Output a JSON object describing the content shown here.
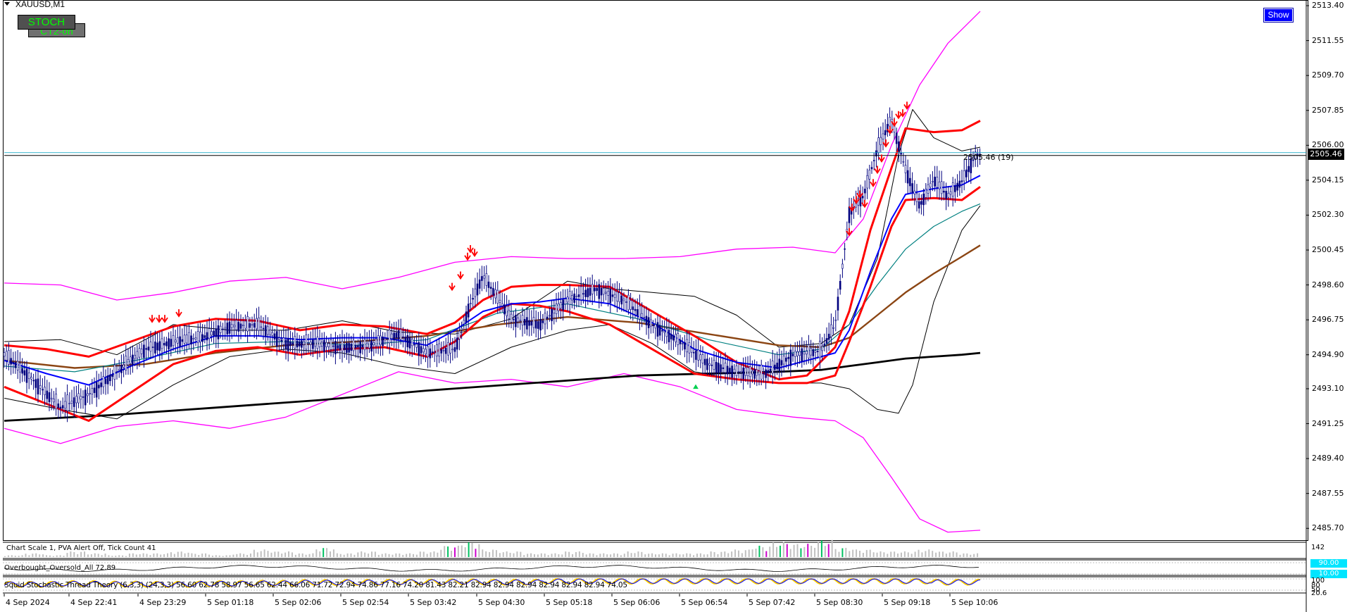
{
  "header": {
    "symbol_label": "XAUUSD,M1"
  },
  "buttons": {
    "stoch_label": "STOCH",
    "ct2_label": "CT2-on",
    "show_label": "Show"
  },
  "bid": {
    "price_label": "2505.46",
    "tick_label": "2505.46 (19)"
  },
  "info_line": {
    "text": "Chart Scale  1,  PVA Alert Off,  Tick Count  41"
  },
  "overbought_line": {
    "text": "Overbought_Oversold_All 72.89"
  },
  "stochastic_line": {
    "text": "Squid Stochastic Thread Theory (6,3,3) (24,3,3) 56.60 62.78 58.97 56.65 62.44 66.06 71.72 72.94 74.86 77.16 74.20 81.43 82.21 82.94 82.94 82.94 82.94 82.94 82.94 74.05"
  },
  "sub_windows": {
    "volume_scale_label": "142",
    "ob_top_label": "90.00",
    "ob_bottom_label": "10.00",
    "stoch_scale_labels": [
      "100",
      "80",
      "50",
      "20.6"
    ]
  },
  "colors": {
    "candle": "#00007f",
    "band_outer": "#ff00ff",
    "band_red": "#ff0000",
    "ma_blue": "#0000ff",
    "ma_teal": "#008080",
    "ma_brown": "#8b4513",
    "ma_black": "#000000",
    "arrow": "#ff0000",
    "volume_bar": "#c0c0c0",
    "volume_green": "#00c060",
    "volume_purple": "#cc00cc",
    "stoch_yellow": "#ffcc00",
    "stoch_blue": "#0000ff"
  },
  "chart_data": {
    "type": "line",
    "title": "XAUUSD,M1",
    "x_labels": [
      "4 Sep 2024",
      "4 Sep 22:41",
      "4 Sep 23:29",
      "5 Sep 01:18",
      "5 Sep 02:06",
      "5 Sep 02:54",
      "5 Sep 03:42",
      "5 Sep 04:30",
      "5 Sep 05:18",
      "5 Sep 06:06",
      "5 Sep 06:54",
      "5 Sep 07:42",
      "5 Sep 08:30",
      "5 Sep 09:18",
      "5 Sep 10:06"
    ],
    "y_ticks": [
      2513.4,
      2511.55,
      2509.7,
      2507.85,
      2506.0,
      2504.15,
      2502.3,
      2500.45,
      2498.6,
      2496.75,
      2494.9,
      2493.1,
      2491.25,
      2489.4,
      2487.55,
      2485.7
    ],
    "ylim": [
      2485.0,
      2513.7
    ],
    "current_price": 2505.46,
    "grid": false,
    "series": [
      {
        "style": "candles",
        "x": [
          0,
          40,
          80,
          120,
          160,
          200,
          240,
          280,
          320,
          360,
          400,
          440,
          480,
          520,
          560,
          600,
          640,
          660,
          680,
          720,
          760,
          800,
          840,
          880,
          920,
          960,
          1000,
          1040,
          1080,
          1120,
          1160,
          1180,
          1200,
          1220,
          1240,
          1260,
          1280,
          1300,
          1320,
          1340,
          1360,
          1380
        ],
        "values": [
          2494.9,
          2493.6,
          2492.1,
          2492.8,
          2494.0,
          2495.2,
          2495.6,
          2495.8,
          2496.4,
          2496.5,
          2495.5,
          2495.5,
          2495.3,
          2495.4,
          2496.0,
          2495.0,
          2495.2,
          2497.4,
          2499.1,
          2496.8,
          2496.5,
          2497.8,
          2498.4,
          2497.8,
          2496.5,
          2495.6,
          2494.4,
          2494.0,
          2493.9,
          2494.9,
          2495.1,
          2496.5,
          2502.4,
          2503.3,
          2505.8,
          2507.4,
          2504.7,
          2502.8,
          2504.2,
          2503.3,
          2504.1,
          2505.5
        ]
      },
      {
        "style": "upper-outer-band",
        "x": [
          0,
          80,
          160,
          240,
          320,
          400,
          480,
          560,
          640,
          720,
          800,
          880,
          960,
          1040,
          1120,
          1180,
          1220,
          1260,
          1300,
          1340,
          1386
        ],
        "values": [
          2498.7,
          2498.6,
          2497.8,
          2498.2,
          2498.8,
          2499.0,
          2498.4,
          2499.0,
          2499.8,
          2500.1,
          2500.0,
          2500.0,
          2500.1,
          2500.5,
          2500.6,
          2500.3,
          2502.1,
          2506.0,
          2509.2,
          2511.4,
          2513.1
        ]
      },
      {
        "style": "lower-outer-band",
        "x": [
          0,
          80,
          160,
          240,
          320,
          400,
          480,
          560,
          640,
          720,
          800,
          880,
          960,
          1040,
          1120,
          1180,
          1220,
          1260,
          1300,
          1340,
          1386
        ],
        "values": [
          2491.0,
          2490.2,
          2491.1,
          2491.4,
          2491.0,
          2491.6,
          2492.8,
          2494.0,
          2493.4,
          2493.6,
          2493.2,
          2493.9,
          2493.2,
          2492.0,
          2491.6,
          2491.4,
          2490.5,
          2488.4,
          2486.2,
          2485.5,
          2485.6
        ]
      },
      {
        "style": "red-upper",
        "x": [
          0,
          60,
          120,
          180,
          240,
          300,
          360,
          420,
          480,
          540,
          600,
          640,
          680,
          720,
          760,
          800,
          860,
          920,
          980,
          1040,
          1100,
          1140,
          1180,
          1200,
          1230,
          1260,
          1280,
          1320,
          1360,
          1386
        ],
        "values": [
          2495.4,
          2495.2,
          2494.8,
          2495.6,
          2496.4,
          2496.8,
          2496.7,
          2496.2,
          2496.5,
          2496.4,
          2496.0,
          2496.6,
          2497.8,
          2498.5,
          2498.6,
          2498.6,
          2498.5,
          2497.2,
          2495.9,
          2494.5,
          2493.6,
          2493.8,
          2495.3,
          2497.2,
          2501.5,
          2504.8,
          2506.9,
          2506.7,
          2506.8,
          2507.3
        ]
      },
      {
        "style": "red-lower",
        "x": [
          0,
          60,
          120,
          180,
          240,
          300,
          360,
          420,
          480,
          540,
          600,
          640,
          680,
          720,
          760,
          800,
          860,
          920,
          980,
          1040,
          1100,
          1140,
          1180,
          1200,
          1230,
          1260,
          1280,
          1320,
          1360,
          1386
        ],
        "values": [
          2493.2,
          2492.3,
          2491.4,
          2492.9,
          2494.4,
          2495.1,
          2495.3,
          2494.9,
          2495.2,
          2495.3,
          2494.8,
          2495.6,
          2496.9,
          2497.6,
          2497.5,
          2497.2,
          2496.5,
          2495.2,
          2493.9,
          2493.6,
          2493.4,
          2493.4,
          2493.8,
          2495.6,
          2498.5,
          2501.7,
          2503.1,
          2503.2,
          2503.1,
          2503.8
        ]
      },
      {
        "style": "blue-ma",
        "x": [
          0,
          60,
          120,
          180,
          240,
          300,
          360,
          420,
          480,
          540,
          600,
          640,
          680,
          720,
          760,
          800,
          860,
          920,
          980,
          1040,
          1100,
          1140,
          1180,
          1200,
          1230,
          1260,
          1280,
          1320,
          1360,
          1386
        ],
        "values": [
          2494.6,
          2493.9,
          2493.3,
          2494.3,
          2495.2,
          2495.9,
          2495.9,
          2495.7,
          2495.8,
          2495.8,
          2495.4,
          2496.2,
          2497.2,
          2497.6,
          2497.7,
          2497.9,
          2497.6,
          2496.6,
          2495.2,
          2494.5,
          2494.2,
          2494.6,
          2495.0,
          2496.2,
          2499.3,
          2502.1,
          2503.4,
          2503.7,
          2503.9,
          2504.4
        ]
      },
      {
        "style": "teal-ma",
        "x": [
          0,
          100,
          200,
          300,
          400,
          500,
          600,
          700,
          800,
          900,
          1000,
          1100,
          1160,
          1200,
          1240,
          1280,
          1320,
          1360,
          1386
        ],
        "values": [
          2494.3,
          2494.0,
          2494.7,
          2495.5,
          2495.6,
          2495.4,
          2495.7,
          2497.1,
          2497.6,
          2496.8,
          2495.7,
          2494.9,
          2495.2,
          2496.5,
          2498.6,
          2500.5,
          2501.7,
          2502.5,
          2502.9
        ]
      },
      {
        "style": "brown-ma",
        "x": [
          0,
          100,
          200,
          300,
          400,
          500,
          600,
          700,
          800,
          900,
          1000,
          1100,
          1160,
          1200,
          1240,
          1280,
          1320,
          1360,
          1386
        ],
        "values": [
          2494.6,
          2494.2,
          2494.4,
          2495.0,
          2495.4,
          2495.6,
          2495.9,
          2496.5,
          2496.9,
          2496.6,
          2496.0,
          2495.4,
          2495.3,
          2495.8,
          2497.0,
          2498.2,
          2499.2,
          2500.1,
          2500.7
        ]
      },
      {
        "style": "black-ma",
        "x": [
          0,
          150,
          300,
          450,
          600,
          750,
          900,
          1000,
          1100,
          1160,
          1200,
          1240,
          1280,
          1320,
          1360,
          1386
        ],
        "values": [
          2491.4,
          2491.7,
          2492.1,
          2492.5,
          2493.0,
          2493.4,
          2493.8,
          2493.9,
          2494.0,
          2494.1,
          2494.3,
          2494.5,
          2494.7,
          2494.8,
          2494.9,
          2495.0
        ]
      },
      {
        "style": "inner-bb-upper",
        "x": [
          0,
          80,
          160,
          240,
          320,
          400,
          480,
          560,
          640,
          720,
          800,
          860,
          920,
          980,
          1040,
          1100,
          1160,
          1200,
          1240,
          1270,
          1290,
          1320,
          1360,
          1386
        ],
        "values": [
          2495.6,
          2495.7,
          2494.9,
          2496.5,
          2496.2,
          2496.2,
          2496.7,
          2496.1,
          2496.0,
          2496.8,
          2498.8,
          2498.4,
          2498.2,
          2498.0,
          2497.0,
          2495.3,
          2495.5,
          2496.5,
          2500.0,
          2505.5,
          2507.9,
          2506.4,
          2505.7,
          2505.9
        ]
      },
      {
        "style": "inner-bb-lower",
        "x": [
          0,
          80,
          160,
          240,
          320,
          400,
          480,
          560,
          640,
          720,
          800,
          860,
          920,
          980,
          1040,
          1100,
          1160,
          1200,
          1240,
          1270,
          1290,
          1320,
          1360,
          1386
        ],
        "values": [
          2492.6,
          2492.0,
          2491.5,
          2493.3,
          2494.8,
          2495.2,
          2495.0,
          2494.3,
          2493.9,
          2495.3,
          2496.2,
          2496.5,
          2495.5,
          2494.0,
          2493.6,
          2493.4,
          2493.4,
          2493.1,
          2492.0,
          2491.8,
          2493.3,
          2497.7,
          2501.5,
          2502.8
        ]
      }
    ],
    "arrows_down": [
      [
        210,
        2496.6
      ],
      [
        220,
        2496.6
      ],
      [
        228,
        2496.6
      ],
      [
        248,
        2496.9
      ],
      [
        636,
        2498.3
      ],
      [
        648,
        2498.9
      ],
      [
        658,
        2499.9
      ],
      [
        662,
        2500.3
      ],
      [
        668,
        2500.1
      ],
      [
        1200,
        2501.2
      ],
      [
        1204,
        2502.5
      ],
      [
        1210,
        2502.9
      ],
      [
        1215,
        2503.2
      ],
      [
        1222,
        2502.7
      ],
      [
        1234,
        2503.8
      ],
      [
        1240,
        2504.5
      ],
      [
        1246,
        2505.1
      ],
      [
        1252,
        2505.9
      ],
      [
        1258,
        2506.6
      ],
      [
        1264,
        2507.0
      ],
      [
        1270,
        2507.4
      ],
      [
        1276,
        2507.5
      ],
      [
        1282,
        2507.9
      ]
    ],
    "arrows_up": [
      [
        982,
        2493.3
      ]
    ],
    "volume": [
      1,
      2,
      1,
      3,
      2,
      1,
      2,
      2,
      3,
      2,
      1,
      2,
      4,
      3,
      2,
      5,
      2,
      3,
      2,
      2,
      3,
      6,
      8,
      4,
      3,
      2,
      2,
      3,
      2,
      2,
      3,
      2,
      2,
      2,
      3,
      4,
      6,
      8,
      7,
      9,
      5,
      4,
      3,
      3,
      4,
      3,
      2
    ],
    "stochastic": [
      56.6,
      62.78,
      58.97,
      56.65,
      62.44,
      66.06,
      71.72,
      72.94,
      74.86,
      77.16,
      74.2,
      81.43,
      82.21,
      82.94,
      82.94,
      82.94,
      82.94,
      82.94,
      82.94,
      74.05
    ]
  }
}
